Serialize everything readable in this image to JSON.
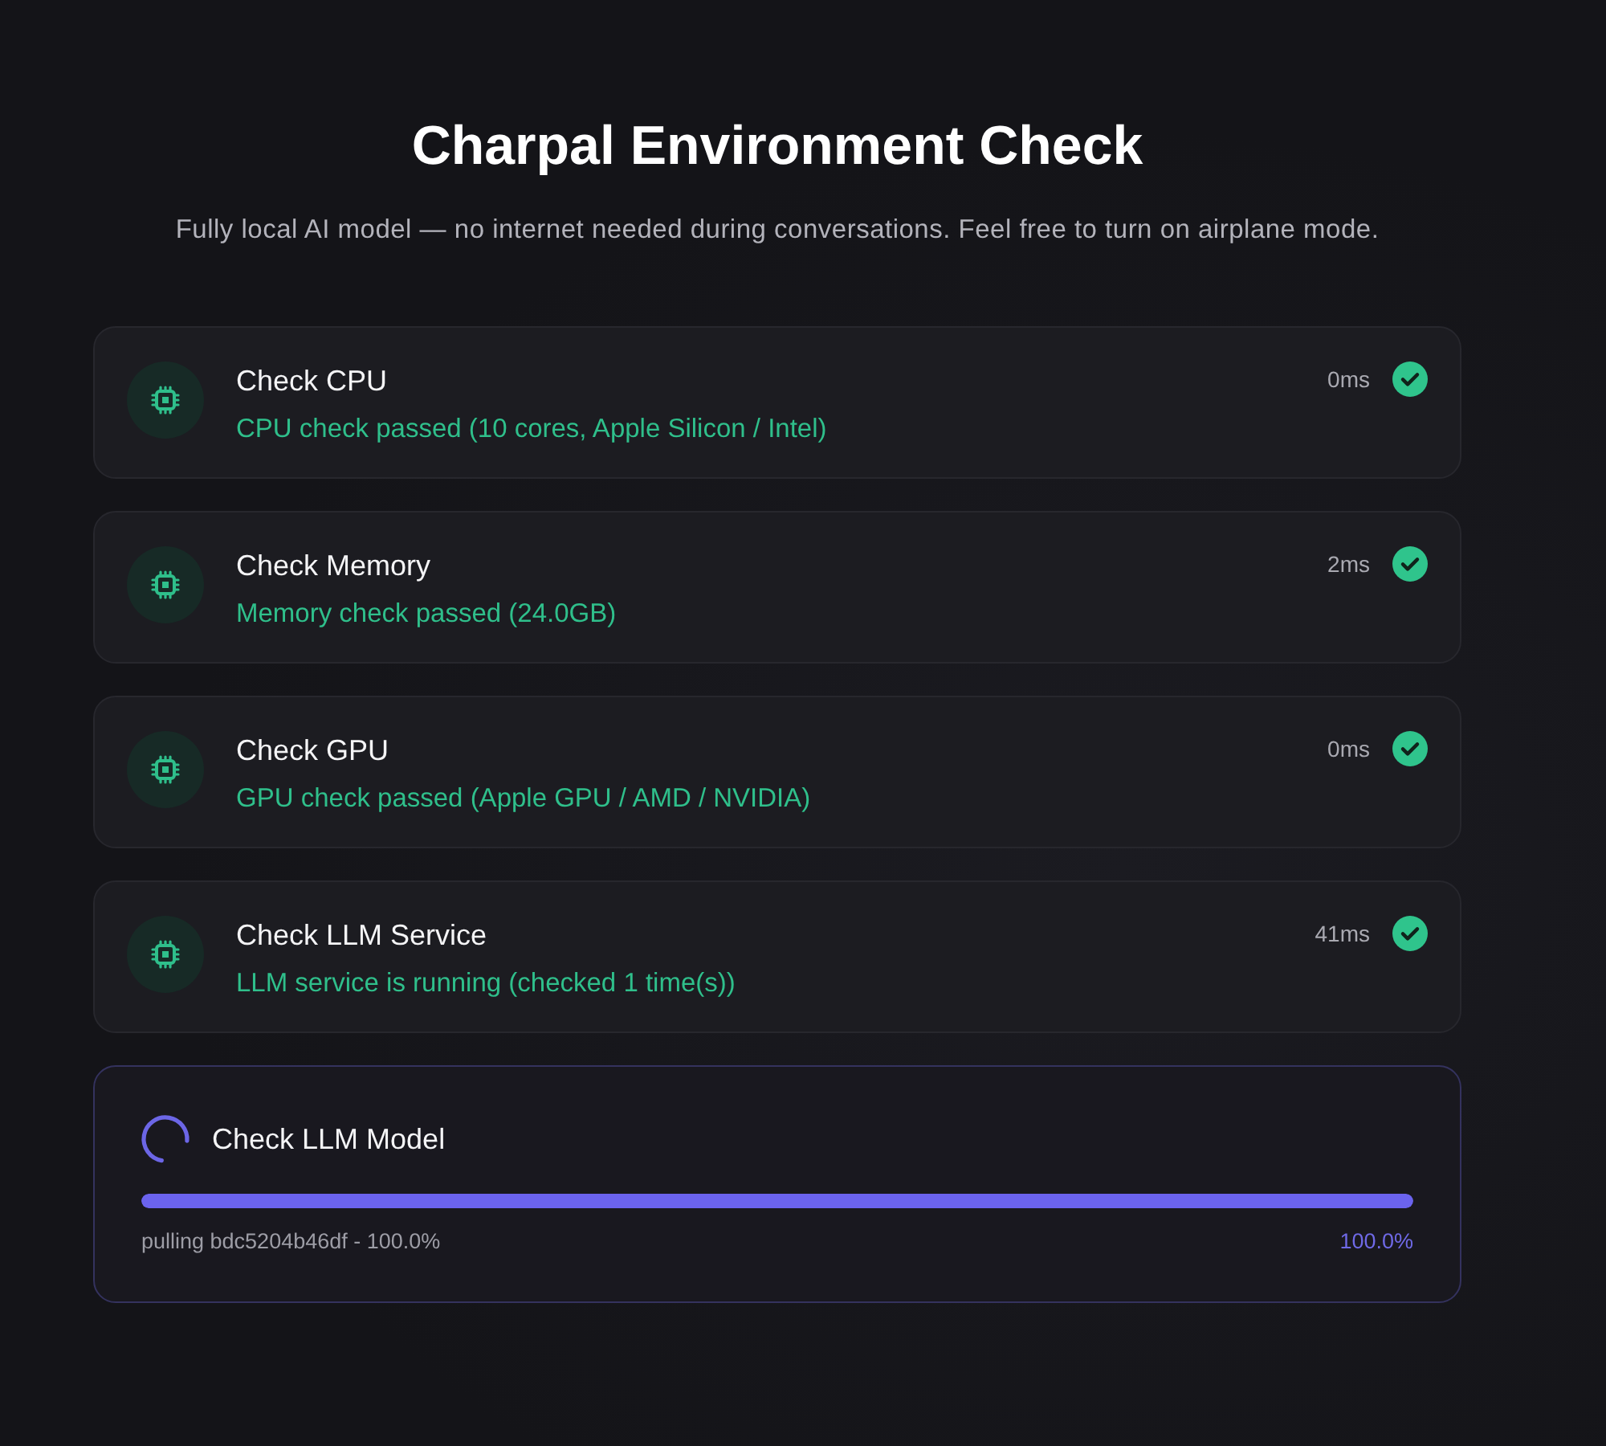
{
  "title": "Charpal Environment Check",
  "subtitle": "Fully local AI model — no internet needed during conversations. Feel free to turn on airplane mode.",
  "checks": [
    {
      "kind": "result",
      "name": "Check CPU",
      "message": "CPU check passed (10 cores, Apple Silicon / Intel)",
      "duration": "0ms",
      "passed": true
    },
    {
      "kind": "result",
      "name": "Check Memory",
      "message": "Memory check passed (24.0GB)",
      "duration": "2ms",
      "passed": true
    },
    {
      "kind": "result",
      "name": "Check GPU",
      "message": "GPU check passed (Apple GPU / AMD / NVIDIA)",
      "duration": "0ms",
      "passed": true
    },
    {
      "kind": "result",
      "name": "Check LLM Service",
      "message": "LLM service is running (checked 1 time(s))",
      "duration": "41ms",
      "passed": true
    },
    {
      "kind": "progress",
      "name": "Check LLM Model",
      "level": 1.0,
      "detail": "pulling bdc5204b46df - 100.0%",
      "percent": "100.0%"
    }
  ]
}
